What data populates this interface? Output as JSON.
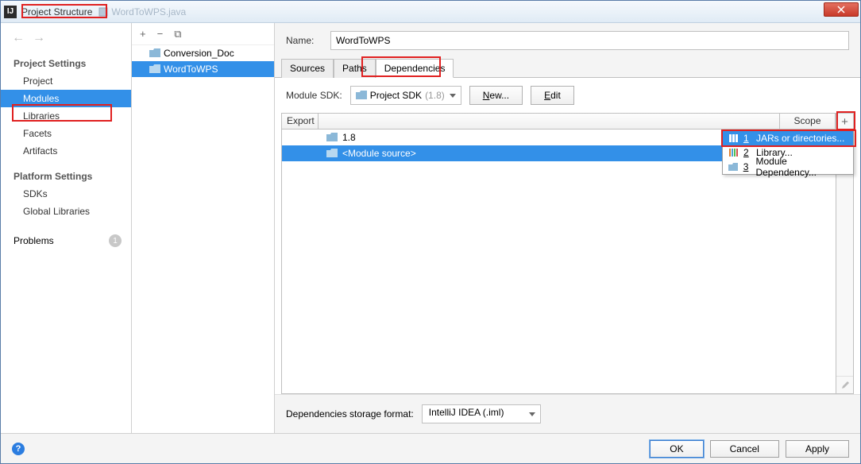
{
  "titlebar": {
    "icon_text": "IJ",
    "title": "Project Structure",
    "faded_tab": "WordToWPS.java"
  },
  "sidebar": {
    "heading1": "Project Settings",
    "items1": [
      "Project",
      "Modules",
      "Libraries",
      "Facets",
      "Artifacts"
    ],
    "heading2": "Platform Settings",
    "items2": [
      "SDKs",
      "Global Libraries"
    ],
    "problems_label": "Problems",
    "problems_count": "1"
  },
  "tree": {
    "items": [
      "Conversion_Doc",
      "WordToWPS"
    ]
  },
  "content": {
    "name_label": "Name:",
    "name_value": "WordToWPS",
    "tabs": [
      "Sources",
      "Paths",
      "Dependencies"
    ],
    "sdk_label": "Module SDK:",
    "sdk_value_prefix": "Project SDK",
    "sdk_value_suffix": "(1.8)",
    "new_btn": "New...",
    "edit_btn": "Edit",
    "header_export": "Export",
    "header_scope": "Scope",
    "deps": [
      {
        "label": "1.8"
      },
      {
        "label": "<Module source>"
      }
    ],
    "popup": [
      {
        "num": "1",
        "label": "JARs or directories..."
      },
      {
        "num": "2",
        "label": "Library..."
      },
      {
        "num": "3",
        "label": "Module Dependency..."
      }
    ],
    "storage_label": "Dependencies storage format:",
    "storage_value": "IntelliJ IDEA (.iml)"
  },
  "footer": {
    "ok": "OK",
    "cancel": "Cancel",
    "apply": "Apply"
  }
}
